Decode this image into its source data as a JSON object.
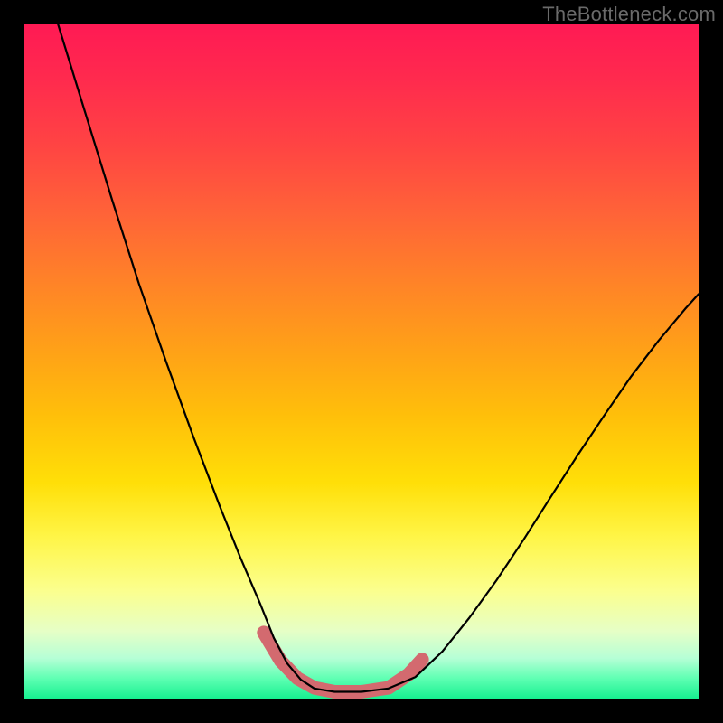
{
  "watermark": "TheBottleneck.com",
  "chart_data": {
    "type": "line",
    "title": "",
    "xlabel": "",
    "ylabel": "",
    "xlim": [
      0,
      1
    ],
    "ylim": [
      0,
      1
    ],
    "annotations": [],
    "series": [
      {
        "name": "bottleneck-curve",
        "color": "#000000",
        "stroke_width": 2.2,
        "x": [
          0.05,
          0.09,
          0.13,
          0.17,
          0.21,
          0.25,
          0.29,
          0.32,
          0.35,
          0.37,
          0.39,
          0.41,
          0.43,
          0.46,
          0.5,
          0.54,
          0.58,
          0.62,
          0.66,
          0.7,
          0.74,
          0.78,
          0.82,
          0.86,
          0.9,
          0.94,
          0.98,
          1.0
        ],
        "y": [
          1.0,
          0.87,
          0.74,
          0.615,
          0.5,
          0.39,
          0.285,
          0.21,
          0.14,
          0.09,
          0.052,
          0.028,
          0.015,
          0.01,
          0.01,
          0.015,
          0.032,
          0.07,
          0.12,
          0.175,
          0.235,
          0.298,
          0.36,
          0.42,
          0.478,
          0.53,
          0.578,
          0.6
        ]
      },
      {
        "name": "optimum-band",
        "color": "#d36a6f",
        "stroke_width": 15,
        "x": [
          0.355,
          0.38,
          0.405,
          0.43,
          0.46,
          0.5,
          0.54,
          0.57,
          0.59
        ],
        "y": [
          0.098,
          0.056,
          0.03,
          0.016,
          0.01,
          0.01,
          0.016,
          0.036,
          0.058
        ]
      }
    ],
    "gradient_stops": [
      {
        "pos": 0.0,
        "color": "#ff1a54"
      },
      {
        "pos": 0.5,
        "color": "#ffbf0a"
      },
      {
        "pos": 0.8,
        "color": "#fff547"
      },
      {
        "pos": 1.0,
        "color": "#16f090"
      }
    ]
  }
}
